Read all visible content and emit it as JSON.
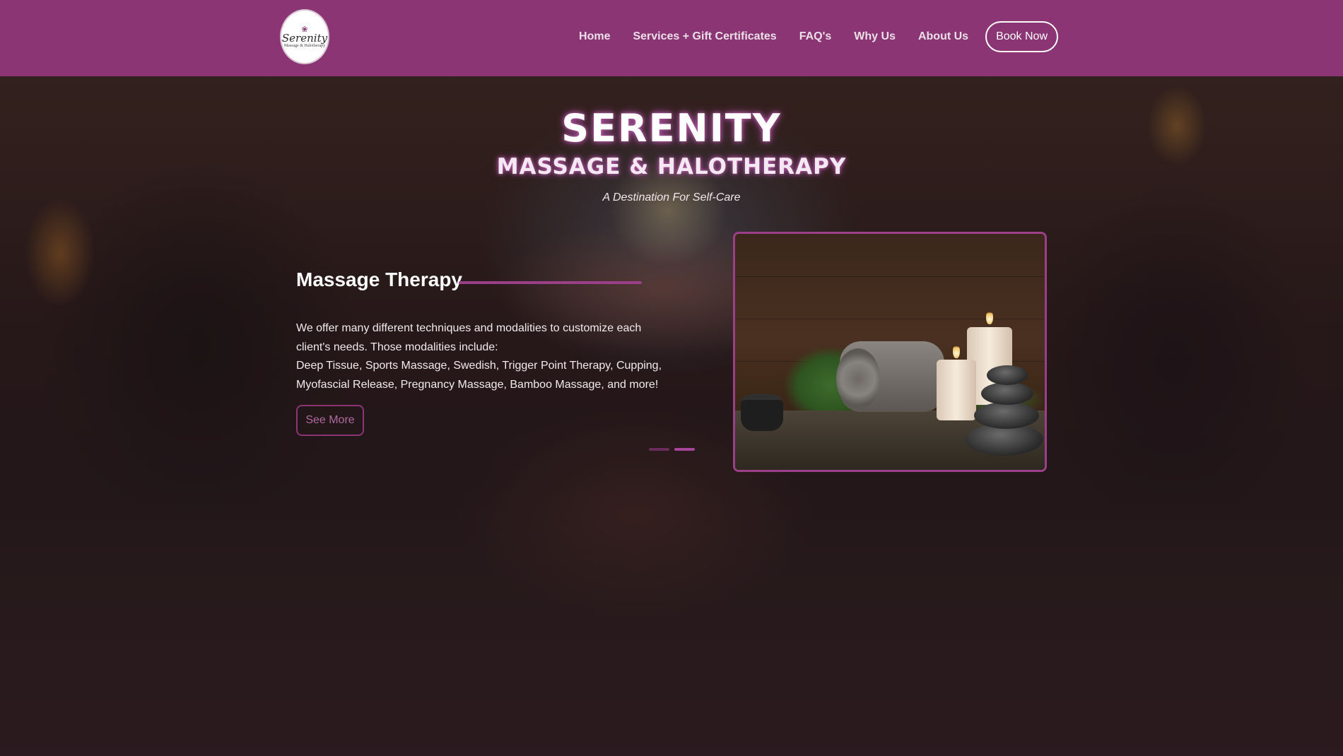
{
  "header": {
    "logo": {
      "script_text": "Serenity",
      "sub_text": "Massage & Halotherapy"
    },
    "nav": [
      {
        "label": "Home"
      },
      {
        "label": "Services + Gift Certificates"
      },
      {
        "label": "FAQ's"
      },
      {
        "label": "Why Us"
      },
      {
        "label": "About Us"
      }
    ],
    "book_label": "Book Now"
  },
  "hero": {
    "title": "SERENITY",
    "subtitle": "MASSAGE & HALOTHERAPY",
    "tagline": "A Destination For Self-Care",
    "section": {
      "title": "Massage Therapy",
      "description_line1": "We offer many different techniques and modalities to customize each client's needs. Those modalities include:",
      "description_line2": "Deep Tissue, Sports Massage, Swedish, Trigger Point Therapy, Cupping, Myofascial Release, Pregnancy Massage, Bamboo Massage, and more!",
      "button_label": "See More"
    },
    "slider": {
      "slide_count": 2,
      "active_index": 1
    }
  },
  "colors": {
    "header_bg": "#8b3575",
    "accent": "#9a3f88",
    "text_light": "#ffffff"
  },
  "icons": [
    "serenity-logo-icon",
    "lotus-icon"
  ]
}
